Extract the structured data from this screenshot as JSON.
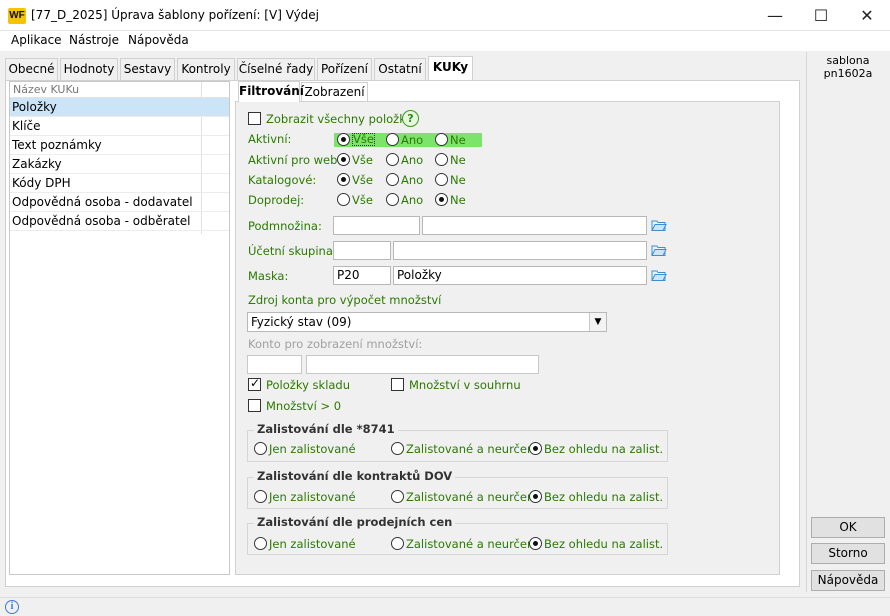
{
  "window": {
    "title": "[77_D_2025] Úprava šablony pořízení: [V] Výdej",
    "logo_text": "WF",
    "minimize": "—",
    "maximize": "☐",
    "close": "✕"
  },
  "menu": [
    "Aplikace",
    "Nástroje",
    "Nápověda"
  ],
  "tabs": [
    "Obecné",
    "Hodnoty",
    "Sestavy",
    "Kontroly",
    "Číselné řady",
    "Pořízení",
    "Ostatní",
    "KUKy"
  ],
  "active_tab": "KUKy",
  "right_info": {
    "line1": "sablona",
    "line2": "pn1602a"
  },
  "kuku_list": {
    "header": "Název KUKu",
    "items": [
      "Položky",
      "Klíče",
      "Text poznámky",
      "Zakázky",
      "Kódy DPH",
      "Odpovědná osoba - dodavatel",
      "Odpovědná osoba - odběratel"
    ],
    "selected": "Položky"
  },
  "inner_tabs": [
    "Filtrování",
    "Zobrazení"
  ],
  "filter": {
    "show_all_label": "Zobrazit všechny položky",
    "help_icon": "?",
    "radio_options": [
      "Vše",
      "Ano",
      "Ne"
    ],
    "radio_rows": [
      {
        "label": "Aktivní:",
        "selected": "Vše"
      },
      {
        "label": "Aktivní pro web:",
        "selected": "Vše"
      },
      {
        "label": "Katalogové:",
        "selected": "Vše"
      },
      {
        "label": "Doprodej:",
        "selected": "Ne"
      }
    ],
    "podmnozina": {
      "label": "Podmnožina:",
      "code": "",
      "name": ""
    },
    "ucetni_skupina": {
      "label": "Účetní skupina:",
      "code": "",
      "name": ""
    },
    "maska": {
      "label": "Maska:",
      "code": "P20",
      "name": "Položky"
    },
    "zdroj_label": "Zdroj konta pro výpočet množství",
    "zdroj_value": "Fyzický stav (09)",
    "konto_label": "Konto pro zobrazení množství:",
    "polozky_skladu": "Položky skladu",
    "mnozstvi_souhrnu": "Množství v souhrnu",
    "mnozstvi_gt0": "Množství > 0",
    "groups": [
      {
        "title": "Zalistování dle *8741",
        "selected": "Bez ohledu na zalist."
      },
      {
        "title": "Zalistování dle kontraktů DOV",
        "selected": "Bez ohledu na zalist."
      },
      {
        "title": "Zalistování dle prodejních cen",
        "selected": "Bez ohledu na zalist."
      }
    ],
    "group_options": [
      "Jen zalistované",
      "Zalistované a neurčené",
      "Bez ohledu na zalist."
    ]
  },
  "buttons": {
    "ok": "OK",
    "storno": "Storno",
    "napoveda": "Nápověda"
  },
  "status_icon": "i",
  "colors": {
    "selection": "#cce4f7",
    "highlight": "#7ce36b",
    "green_text": "#2a7a00",
    "logo": "#f5c400",
    "folder": "#3a8fd4"
  }
}
